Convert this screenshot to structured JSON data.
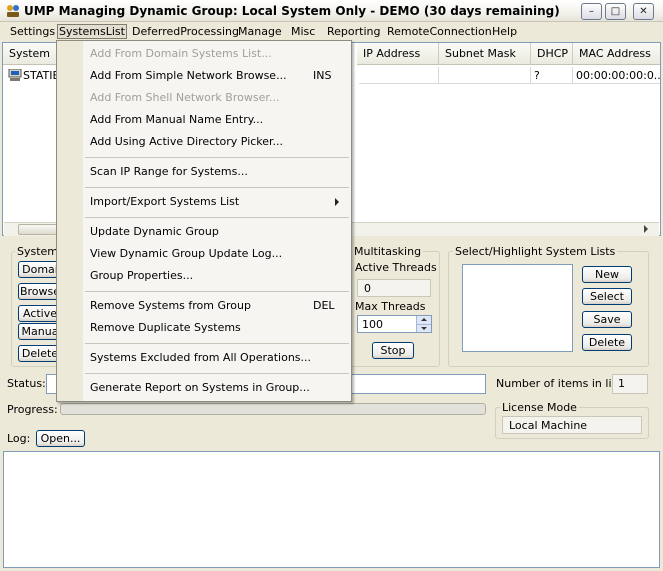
{
  "window": {
    "title": "UMP Managing Dynamic Group: Local System Only - DEMO (30 days remaining)",
    "controls": {
      "minimize": "–",
      "maximize": "□",
      "close": "✕"
    }
  },
  "menubar": {
    "settings": "Settings",
    "systemslist": "SystemsList",
    "deferredprocessing": "DeferredProcessing",
    "manage": "Manage",
    "misc": "Misc",
    "reporting": "Reporting",
    "remoteconnection": "RemoteConnection",
    "help": "Help"
  },
  "list": {
    "columns": {
      "system": "System",
      "ip": "IP Address",
      "subnet": "Subnet Mask",
      "dhcp": "DHCP",
      "mac": "MAC Address"
    },
    "row": {
      "system": "STATIE",
      "ip": "",
      "subnet": "",
      "dhcp": "?",
      "mac": "00:00:00:00:0..."
    }
  },
  "systems_group": {
    "title": "Systems",
    "buttons": [
      "Domai",
      "Browse",
      "Active",
      "Manua",
      "Delete"
    ]
  },
  "multitasking": {
    "title": "Multitasking",
    "active_threads_label": "Active Threads",
    "active_threads_value": "0",
    "max_threads_label": "Max Threads",
    "max_threads_value": "100",
    "stop_label": "Stop"
  },
  "highlight": {
    "title": "Select/Highlight System Lists",
    "new": "New",
    "select": "Select",
    "save": "Save",
    "delete": "Delete"
  },
  "status": {
    "label": "Status:",
    "items_label": "Number of items in list:",
    "items_value": "1"
  },
  "progress": {
    "label": "Progress:",
    "value": 0
  },
  "license": {
    "title": "License Mode",
    "value": "Local Machine"
  },
  "log": {
    "label": "Log:",
    "open_label": "Open..."
  },
  "dropdown": {
    "items": [
      {
        "label": "Add From Domain Systems List...",
        "shortcut": "",
        "disabled": true
      },
      {
        "label": "Add From Simple Network Browse...",
        "shortcut": "INS",
        "disabled": false
      },
      {
        "label": "Add From Shell Network Browser...",
        "shortcut": "",
        "disabled": true
      },
      {
        "label": "Add From Manual Name Entry...",
        "shortcut": "",
        "disabled": false
      },
      {
        "label": "Add Using Active Directory Picker...",
        "shortcut": "",
        "disabled": false
      },
      {
        "label": "Scan IP Range for Systems...",
        "shortcut": "",
        "disabled": false
      },
      {
        "label": "Import/Export Systems List",
        "shortcut": "",
        "disabled": false,
        "submenu": true
      },
      {
        "label": "Update Dynamic Group",
        "shortcut": "",
        "disabled": false
      },
      {
        "label": "View Dynamic Group Update Log...",
        "shortcut": "",
        "disabled": false
      },
      {
        "label": "Group Properties...",
        "shortcut": "",
        "disabled": false
      },
      {
        "label": "Remove Systems from Group",
        "shortcut": "DEL",
        "disabled": false
      },
      {
        "label": "Remove Duplicate Systems",
        "shortcut": "",
        "disabled": false
      },
      {
        "label": "Systems Excluded from All Operations...",
        "shortcut": "",
        "disabled": false
      },
      {
        "label": "Generate Report on Systems in Group...",
        "shortcut": "",
        "disabled": false
      }
    ]
  }
}
